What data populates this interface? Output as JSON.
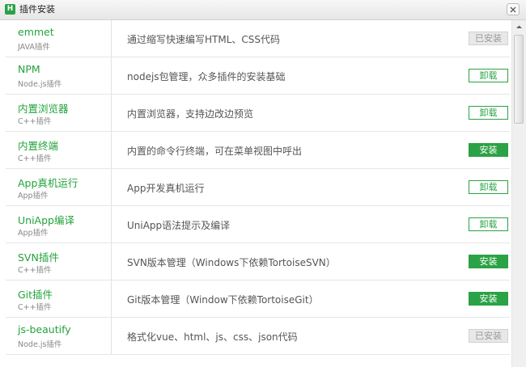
{
  "window": {
    "title": "插件安装",
    "app_icon": "hbuilder-logo-icon",
    "app_icon_letter": "H",
    "close_icon": "close-icon"
  },
  "colors": {
    "accent": "#2ba245",
    "name_text": "#22a33c",
    "installed_bg": "#e8e8e8"
  },
  "plugins": [
    {
      "name": "emmet",
      "type": "JAVA插件",
      "desc": "通过缩写快速编写HTML、CSS代码",
      "action": "已安装",
      "state": "installed"
    },
    {
      "name": "NPM",
      "type": "Node.js插件",
      "desc": "nodejs包管理，众多插件的安装基础",
      "action": "卸载",
      "state": "uninstall"
    },
    {
      "name": "内置浏览器",
      "type": "C++插件",
      "desc": "内置浏览器，支持边改边预览",
      "action": "卸载",
      "state": "uninstall"
    },
    {
      "name": "内置终端",
      "type": "C++插件",
      "desc": "内置的命令行终端，可在菜单视图中呼出",
      "action": "安装",
      "state": "install"
    },
    {
      "name": "App真机运行",
      "type": "App插件",
      "desc": "App开发真机运行",
      "action": "卸载",
      "state": "uninstall"
    },
    {
      "name": "UniApp编译",
      "type": "App插件",
      "desc": "UniApp语法提示及编译",
      "action": "卸载",
      "state": "uninstall"
    },
    {
      "name": "SVN插件",
      "type": "C++插件",
      "desc": "SVN版本管理（Windows下依赖TortoiseSVN）",
      "action": "安装",
      "state": "install"
    },
    {
      "name": "Git插件",
      "type": "C++插件",
      "desc": "Git版本管理（Window下依赖TortoiseGit）",
      "action": "安装",
      "state": "install"
    },
    {
      "name": "js-beautify",
      "type": "Node.js插件",
      "desc": "格式化vue、html、js、css、json代码",
      "action": "已安装",
      "state": "installed"
    }
  ]
}
